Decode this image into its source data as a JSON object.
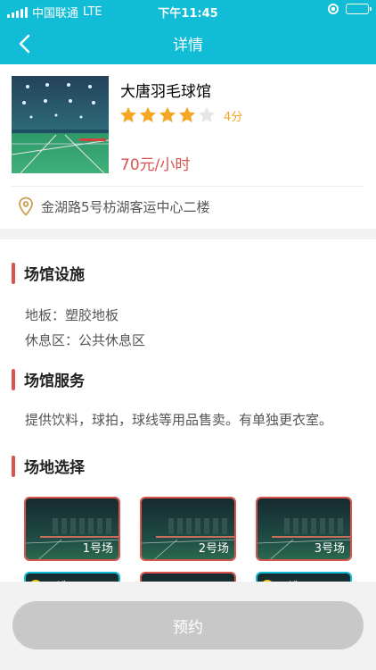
{
  "status_bar": {
    "carrier": "中国联通",
    "network": "LTE",
    "time": "下午11:45",
    "signal_icon": "signal-bars-icon",
    "orientation_lock_icon": "orientation-lock-icon",
    "battery_icon": "battery-icon",
    "battery_level": 0.7
  },
  "nav": {
    "title": "详情",
    "back_icon": "chevron-left-icon",
    "background": "#10bcd6"
  },
  "venue": {
    "name": "大唐羽毛球馆",
    "rating": 4,
    "rating_max": 5,
    "rating_text": "4分",
    "price": "70元/小时",
    "address": "金湖路5号枋湖客运中心二楼",
    "address_icon": "location-pin-icon",
    "star_color": "#f5a623",
    "price_color": "#d9534f"
  },
  "facilities": {
    "title": "场馆设施",
    "lines": [
      "地板：塑胶地板",
      "休息区：公共休息区"
    ]
  },
  "services": {
    "title": "场馆服务",
    "text": "提供饮料，球拍，球线等用品售卖。有单独更衣室。"
  },
  "courts": {
    "title": "场地选择",
    "items": [
      {
        "label": "1号场"
      },
      {
        "label": "2号场"
      },
      {
        "label": "3号场"
      }
    ],
    "partial_items": [
      {
        "status": "可选"
      },
      {
        "status": ""
      },
      {
        "status": "可选"
      }
    ],
    "accent": "#d9534f"
  },
  "booking": {
    "button_label": "预约"
  }
}
